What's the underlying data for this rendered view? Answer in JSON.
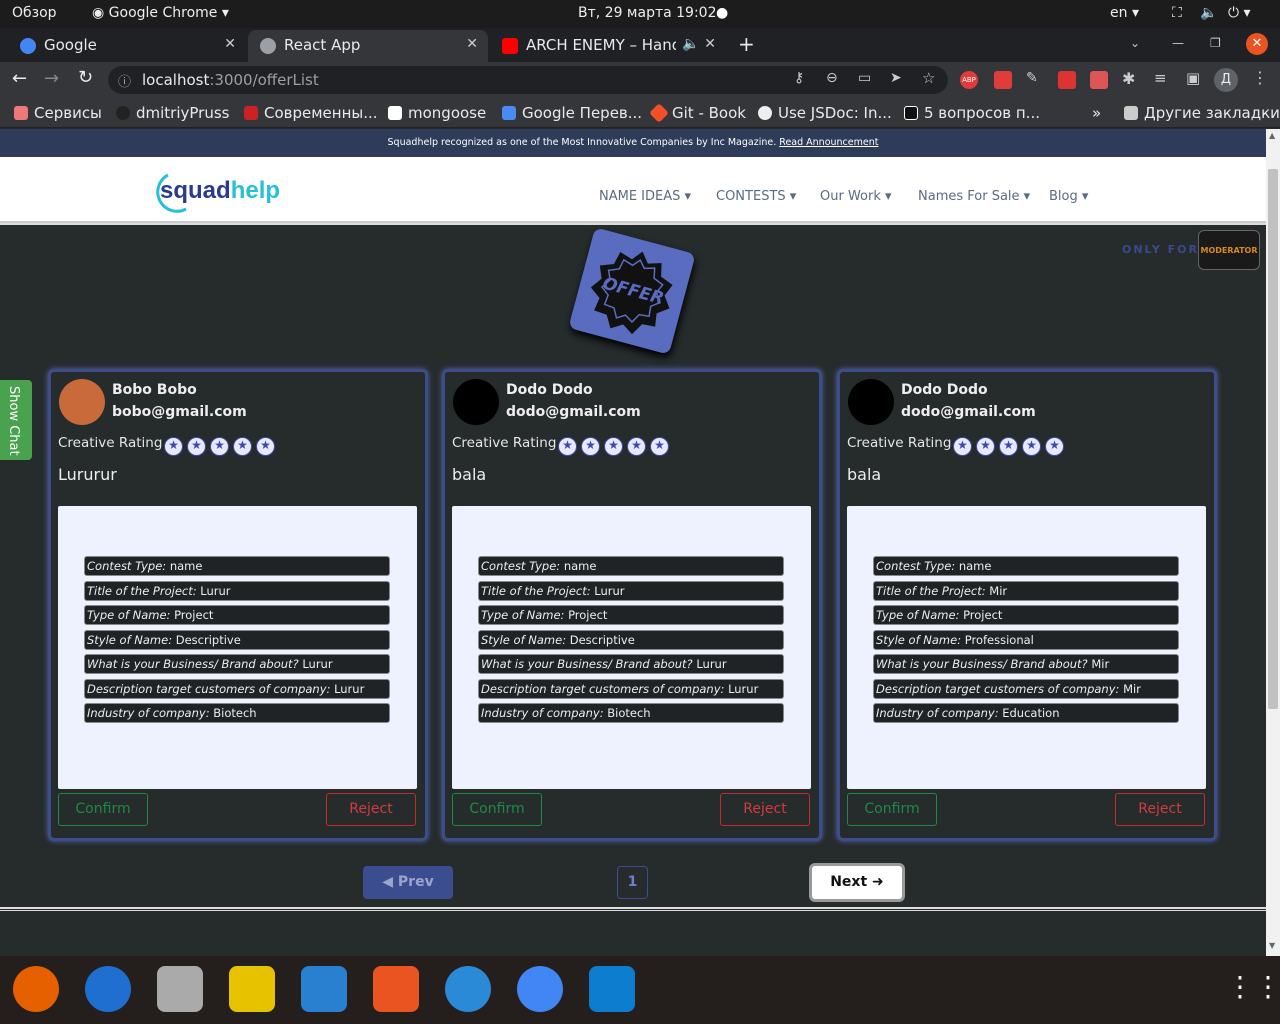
{
  "gnome": {
    "activities": "Обзор",
    "app_menu": "Google Chrome",
    "datetime": "Вт, 29 марта  19:02",
    "lang": "en"
  },
  "tabs": [
    {
      "label": "Google"
    },
    {
      "label": "React App"
    },
    {
      "label": "ARCH ENEMY – Hands"
    }
  ],
  "address": {
    "host": "localhost",
    "path": ":3000/offerList"
  },
  "bookmarks": [
    "Сервисы",
    "dmitriyPruss",
    "Современны...",
    "mongoose",
    "Google Перев...",
    "Git - Book",
    "Use JSDoc: In...",
    "5 вопросов п...",
    "Другие закладки"
  ],
  "banner": {
    "text": "Squadhelp recognized as one of the Most Innovative Companies by Inc Magazine.",
    "link": "Read Announcement"
  },
  "logo": {
    "a": "squad",
    "b": "help"
  },
  "nav": [
    "NAME IDEAS",
    "CONTESTS",
    "Our Work",
    "Names For Sale",
    "Blog"
  ],
  "offer_badge": "OFFER",
  "only_for": "ONLY FOR",
  "moderator": "MODERATOR",
  "show_chat": "Show Chat",
  "rating_label": "Creative Rating",
  "confirm_label": "Confirm",
  "reject_label": "Reject",
  "offers": [
    {
      "name": "Bobo Bobo",
      "email": "bobo@gmail.com",
      "text": "Lururur",
      "rating": 0,
      "fields": [
        [
          "Contest Type:",
          "name"
        ],
        [
          "Title of the Project:",
          "Lurur"
        ],
        [
          "Type of Name:",
          "Project"
        ],
        [
          "Style of Name:",
          "Descriptive"
        ],
        [
          "What is your Business/ Brand about?",
          "Lurur"
        ],
        [
          "Description target customers of company:",
          "Lurur"
        ],
        [
          "Industry of company:",
          "Biotech"
        ]
      ]
    },
    {
      "name": "Dodo Dodo",
      "email": "dodo@gmail.com",
      "text": "bala",
      "rating": 0,
      "fields": [
        [
          "Contest Type:",
          "name"
        ],
        [
          "Title of the Project:",
          "Lurur"
        ],
        [
          "Type of Name:",
          "Project"
        ],
        [
          "Style of Name:",
          "Descriptive"
        ],
        [
          "What is your Business/ Brand about?",
          "Lurur"
        ],
        [
          "Description target customers of company:",
          "Lurur"
        ],
        [
          "Industry of company:",
          "Biotech"
        ]
      ]
    },
    {
      "name": "Dodo Dodo",
      "email": "dodo@gmail.com",
      "text": "bala",
      "rating": 0,
      "fields": [
        [
          "Contest Type:",
          "name"
        ],
        [
          "Title of the Project:",
          "Mir"
        ],
        [
          "Type of Name:",
          "Project"
        ],
        [
          "Style of Name:",
          "Professional"
        ],
        [
          "What is your Business/ Brand about?",
          "Mir"
        ],
        [
          "Description target customers of company:",
          "Mir"
        ],
        [
          "Industry of company:",
          "Education"
        ]
      ]
    }
  ],
  "pagination": {
    "prev": "Prev",
    "page": "1",
    "next": "Next"
  }
}
